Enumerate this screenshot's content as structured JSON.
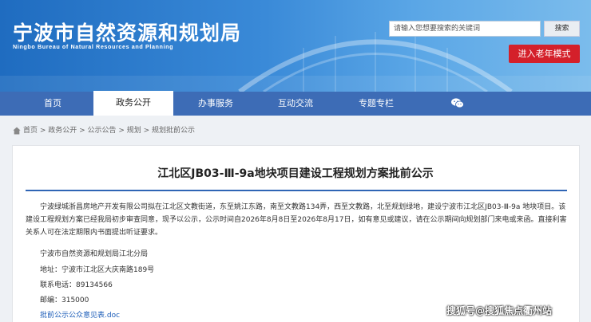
{
  "header": {
    "title": "宁波市自然资源和规划局",
    "subtitle": "Ningbo Bureau of Natural Resources and Planning"
  },
  "search": {
    "placeholder": "请输入您想要搜索的关键词",
    "button_label": "搜索"
  },
  "elder_mode_label": "进入老年模式",
  "nav": {
    "items": [
      {
        "label": "首页"
      },
      {
        "label": "政务公开",
        "active": true
      },
      {
        "label": "办事服务"
      },
      {
        "label": "互动交流"
      },
      {
        "label": "专题专栏"
      }
    ],
    "wechat_icon": "wechat-icon"
  },
  "breadcrumb": {
    "home_icon": "home-icon",
    "text": "首页 > 政务公开 > 公示公告 > 规划 > 规划批前公示"
  },
  "article": {
    "title": "江北区JB03-Ⅲ-9a地块项目建设工程规划方案批前公示",
    "paragraph": "宁波绿城浙昌房地产开发有限公司拟在江北区文教街道，东至姚江东路，南至文教路134弄，西至文教路，北至规划绿地，建设宁波市江北区JB03-Ⅲ-9a 地块项目。该建设工程规划方案已经我局初步审查同意，现予以公示，公示时间自2026年8月8日至2026年8月17日，如有意见或建议，请在公示期间向规划部门来电或来函。直接利害关系人可在法定期限内书面提出听证要求。",
    "org": "宁波市自然资源和规划局江北分局",
    "address": "地址：宁波市江北区大庆南路189号",
    "phone": "联系电话：89134566",
    "postcode": "邮编：315000",
    "attachment": "批前公示公众意见表.doc"
  },
  "watermark": "搜狐号@搜狐焦点衢州站",
  "colors": {
    "nav_bg": "#3d6cb6",
    "elder_button": "#d4202a",
    "title_rule": "#2f65b5",
    "link": "#1b5cb8"
  }
}
